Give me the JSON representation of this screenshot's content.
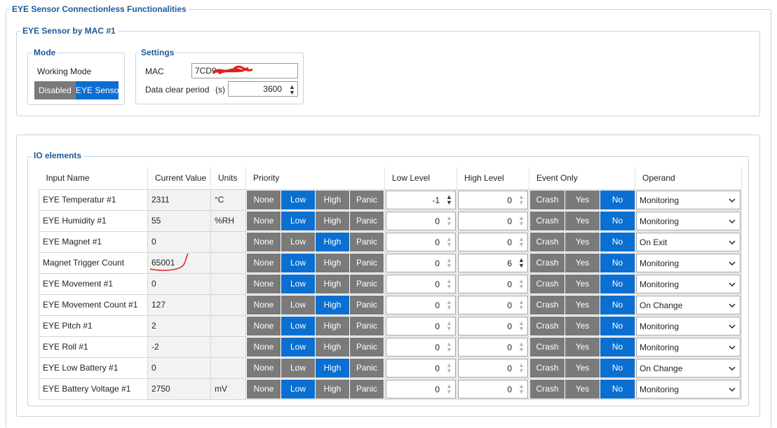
{
  "outer_group": {
    "title": "EYE Sensor Connectionless Functionalities"
  },
  "sensor_group": {
    "title": "EYE Sensor by MAC #1"
  },
  "mode": {
    "title": "Mode",
    "working_mode_label": "Working Mode",
    "options": [
      "Disabled",
      "EYE Sensor"
    ],
    "selected": "EYE Sensor"
  },
  "settings": {
    "title": "Settings",
    "mac_label": "MAC",
    "mac_value": "7CD9",
    "data_clear_label": "Data clear period",
    "data_clear_unit": "(s)",
    "data_clear_value": "3600"
  },
  "io": {
    "title": "IO elements",
    "columns": [
      "Input Name",
      "Current Value",
      "Units",
      "Priority",
      "Low Level",
      "High Level",
      "Event Only",
      "Operand"
    ],
    "priority_options": [
      "None",
      "Low",
      "High",
      "Panic"
    ],
    "event_options": [
      "Crash",
      "Yes",
      "No"
    ],
    "rows": [
      {
        "name": "EYE Temperatur #1",
        "value": "2311",
        "units": "°C",
        "priority": "Low",
        "low": "-1",
        "high": "0",
        "event": "No",
        "operand": "Monitoring"
      },
      {
        "name": "EYE Humidity #1",
        "value": "55",
        "units": "%RH",
        "priority": "Low",
        "low": "0",
        "high": "0",
        "event": "No",
        "operand": "Monitoring"
      },
      {
        "name": "EYE Magnet #1",
        "value": "0",
        "units": "",
        "priority": "High",
        "low": "0",
        "high": "0",
        "event": "No",
        "operand": "On Exit"
      },
      {
        "name": "Magnet Trigger Count",
        "value": "65001",
        "units": "",
        "priority": "Low",
        "low": "0",
        "high": "6",
        "event": "No",
        "operand": "Monitoring"
      },
      {
        "name": "EYE Movement #1",
        "value": "0",
        "units": "",
        "priority": "Low",
        "low": "0",
        "high": "0",
        "event": "No",
        "operand": "Monitoring"
      },
      {
        "name": "EYE Movement Count #1",
        "value": "127",
        "units": "",
        "priority": "High",
        "low": "0",
        "high": "0",
        "event": "No",
        "operand": "On Change"
      },
      {
        "name": "EYE Pitch #1",
        "value": "2",
        "units": "",
        "priority": "Low",
        "low": "0",
        "high": "0",
        "event": "No",
        "operand": "Monitoring"
      },
      {
        "name": "EYE Roll #1",
        "value": "-2",
        "units": "",
        "priority": "Low",
        "low": "0",
        "high": "0",
        "event": "No",
        "operand": "Monitoring"
      },
      {
        "name": "EYE Low Battery #1",
        "value": "0",
        "units": "",
        "priority": "High",
        "low": "0",
        "high": "0",
        "event": "No",
        "operand": "On Change"
      },
      {
        "name": "EYE Battery Voltage #1",
        "value": "2750",
        "units": "mV",
        "priority": "Low",
        "low": "0",
        "high": "0",
        "event": "No",
        "operand": "Monitoring"
      }
    ]
  },
  "colors": {
    "accent": "#0a6fd0",
    "button_gray": "#7a7a7a",
    "group_title": "#1c5a9a",
    "annotation": "#e0201c"
  }
}
